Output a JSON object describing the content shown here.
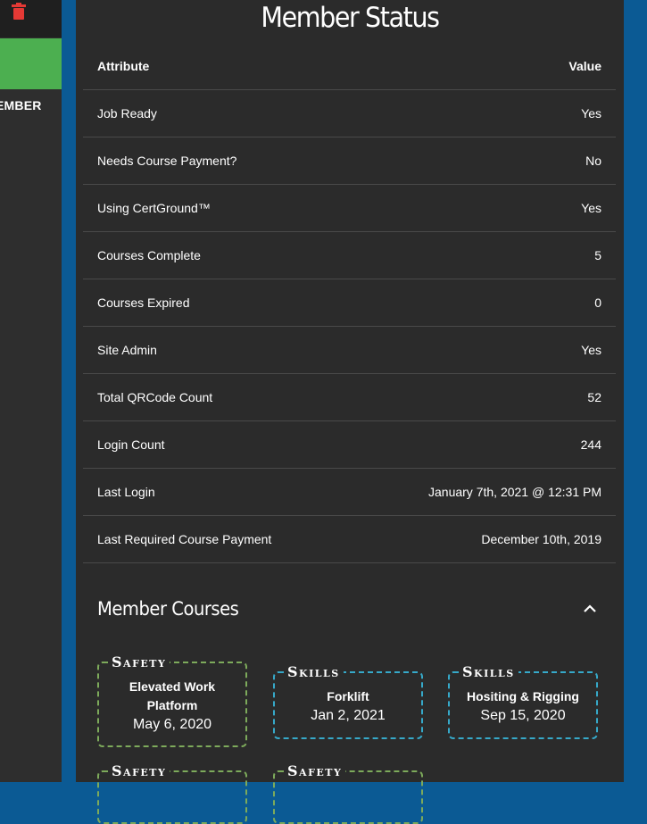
{
  "sidebar": {
    "member_label": "EMBER",
    "colors": {
      "action_button": "#4caf50",
      "trash": "#e53935"
    }
  },
  "status": {
    "title": "Member Status",
    "header": {
      "attribute": "Attribute",
      "value": "Value"
    },
    "rows": [
      {
        "label": "Job Ready",
        "value": "Yes"
      },
      {
        "label": "Needs Course Payment?",
        "value": "No"
      },
      {
        "label": "Using CertGround™",
        "value": "Yes"
      },
      {
        "label": "Courses Complete",
        "value": "5"
      },
      {
        "label": "Courses Expired",
        "value": "0"
      },
      {
        "label": "Site Admin",
        "value": "Yes"
      },
      {
        "label": "Total QRCode Count",
        "value": "52"
      },
      {
        "label": "Login Count",
        "value": "244"
      },
      {
        "label": "Last Login",
        "value": "January 7th, 2021 @ 12:31 PM"
      },
      {
        "label": "Last Required Course Payment",
        "value": "December 10th, 2019"
      }
    ]
  },
  "courses": {
    "title": "Member Courses",
    "toggle_icon": "chevron-up-icon",
    "colors": {
      "safety": "#7daa5b",
      "skills": "#36a9c9"
    },
    "items": [
      {
        "category": "Safety",
        "name": "Elevated Work Platform",
        "date": "May 6, 2020"
      },
      {
        "category": "Skills",
        "name": "Forklift",
        "date": "Jan 2, 2021"
      },
      {
        "category": "Skills",
        "name": "Hositing & Rigging",
        "date": "Sep 15, 2020"
      },
      {
        "category": "Safety",
        "name": "",
        "date": ""
      },
      {
        "category": "Safety",
        "name": "",
        "date": ""
      }
    ]
  }
}
